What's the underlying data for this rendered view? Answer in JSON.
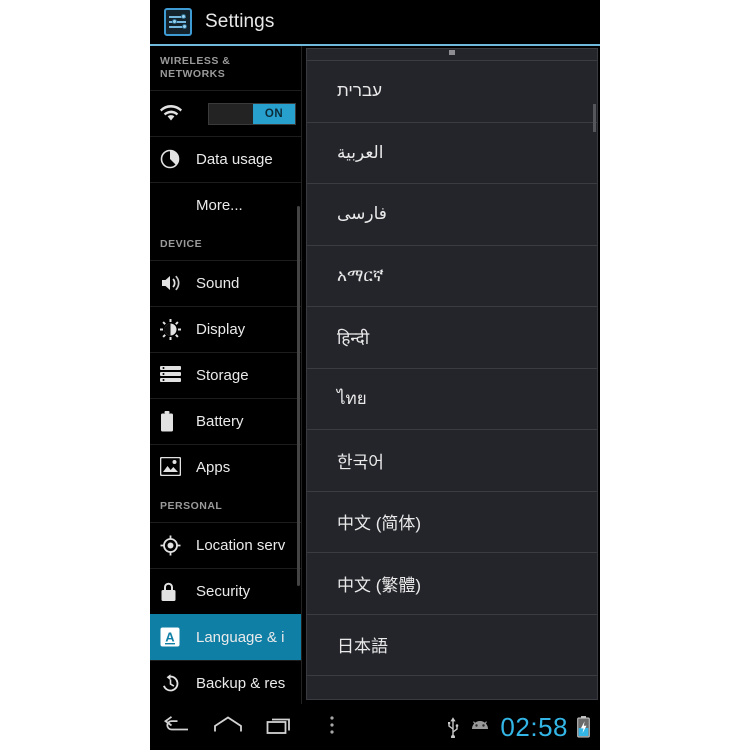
{
  "actionbar": {
    "title": "Settings",
    "icon": "settings-sliders-icon"
  },
  "sidebar": {
    "sections": [
      {
        "header": "WIRELESS &\nNETWORKS",
        "items": [
          {
            "label": "",
            "icon": "wifi-icon",
            "toggle": {
              "state": "ON",
              "label": "ON"
            }
          },
          {
            "label": "Data usage",
            "icon": "data-usage-pie-icon"
          },
          {
            "label": "More...",
            "icon": ""
          }
        ]
      },
      {
        "header": "DEVICE",
        "items": [
          {
            "label": "Sound",
            "icon": "speaker-icon"
          },
          {
            "label": "Display",
            "icon": "brightness-icon"
          },
          {
            "label": "Storage",
            "icon": "storage-stack-icon"
          },
          {
            "label": "Battery",
            "icon": "battery-icon"
          },
          {
            "label": "Apps",
            "icon": "apps-image-icon"
          }
        ]
      },
      {
        "header": "PERSONAL",
        "items": [
          {
            "label": "Location serv",
            "icon": "location-target-icon"
          },
          {
            "label": "Security",
            "icon": "lock-icon"
          },
          {
            "label": "Language & i",
            "icon": "language-a-icon",
            "selected": true
          },
          {
            "label": "Backup & res",
            "icon": "backup-restore-icon"
          }
        ]
      }
    ],
    "selected_accent": "#0f7fa6"
  },
  "language_list": {
    "rows": [
      {
        "label": "",
        "partial": true
      },
      {
        "label": "עברית"
      },
      {
        "label": "العربية"
      },
      {
        "label": "فارسی"
      },
      {
        "label": "አማርኛ"
      },
      {
        "label": "हिन्दी"
      },
      {
        "label": "ไทย"
      },
      {
        "label": "한국어"
      },
      {
        "label": "中文 (简体)"
      },
      {
        "label": "中文 (繁體)"
      },
      {
        "label": "日本語"
      }
    ]
  },
  "navbar": {
    "buttons": [
      {
        "name": "back",
        "icon": "back-arrow-icon"
      },
      {
        "name": "home",
        "icon": "home-icon"
      },
      {
        "name": "recents",
        "icon": "recents-icon"
      },
      {
        "name": "menu",
        "icon": "overflow-menu-icon"
      }
    ],
    "status": {
      "usb": "usb-icon",
      "android": "android-head-icon",
      "clock": "02:58",
      "clock_color": "#33b5e5",
      "battery": "battery-charging-icon"
    }
  }
}
